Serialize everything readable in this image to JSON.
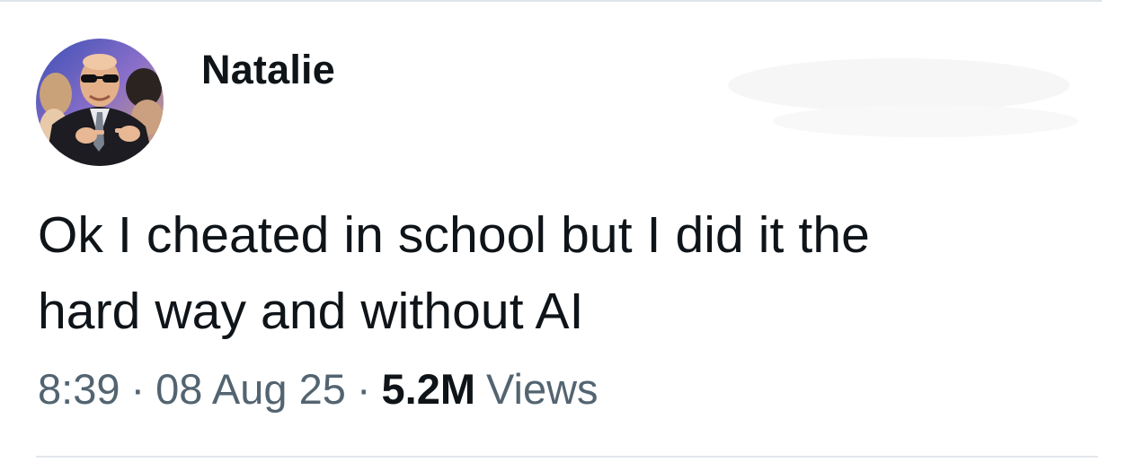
{
  "post": {
    "author": {
      "display_name": "Natalie"
    },
    "text_lines": [
      "Ok I cheated in school but I did it the",
      "hard way and without AI"
    ],
    "time": "8:39",
    "separator": "·",
    "date": "08 Aug 25",
    "views_count": "5.2M",
    "views_label": "Views"
  },
  "colors": {
    "primary_text": "#0f1419",
    "secondary_text": "#536471",
    "divider": "#e3e8ec",
    "background": "#ffffff"
  },
  "icons": {
    "avatar": "profile-photo"
  }
}
